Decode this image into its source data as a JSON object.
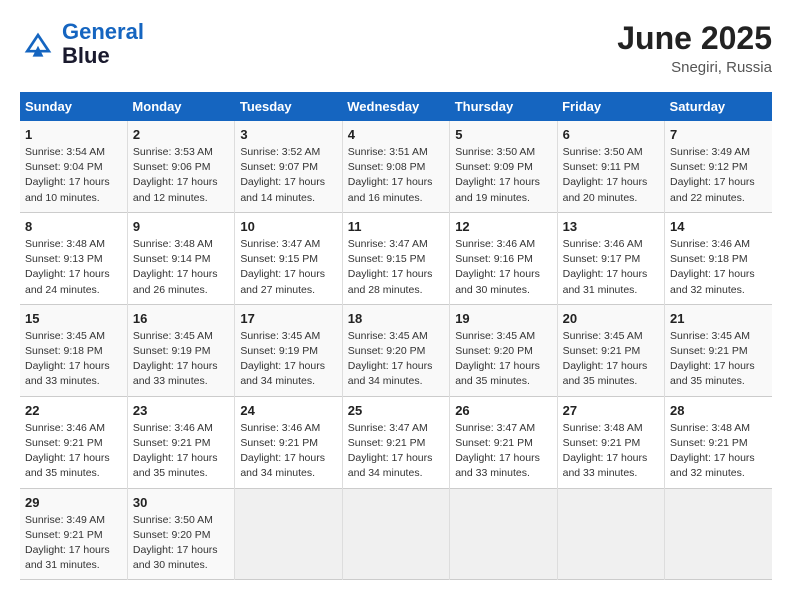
{
  "logo": {
    "line1": "General",
    "line2": "Blue"
  },
  "title": "June 2025",
  "subtitle": "Snegiri, Russia",
  "days_header": [
    "Sunday",
    "Monday",
    "Tuesday",
    "Wednesday",
    "Thursday",
    "Friday",
    "Saturday"
  ],
  "weeks": [
    [
      {
        "num": "1",
        "lines": [
          "Sunrise: 3:54 AM",
          "Sunset: 9:04 PM",
          "Daylight: 17 hours",
          "and 10 minutes."
        ]
      },
      {
        "num": "2",
        "lines": [
          "Sunrise: 3:53 AM",
          "Sunset: 9:06 PM",
          "Daylight: 17 hours",
          "and 12 minutes."
        ]
      },
      {
        "num": "3",
        "lines": [
          "Sunrise: 3:52 AM",
          "Sunset: 9:07 PM",
          "Daylight: 17 hours",
          "and 14 minutes."
        ]
      },
      {
        "num": "4",
        "lines": [
          "Sunrise: 3:51 AM",
          "Sunset: 9:08 PM",
          "Daylight: 17 hours",
          "and 16 minutes."
        ]
      },
      {
        "num": "5",
        "lines": [
          "Sunrise: 3:50 AM",
          "Sunset: 9:09 PM",
          "Daylight: 17 hours",
          "and 19 minutes."
        ]
      },
      {
        "num": "6",
        "lines": [
          "Sunrise: 3:50 AM",
          "Sunset: 9:11 PM",
          "Daylight: 17 hours",
          "and 20 minutes."
        ]
      },
      {
        "num": "7",
        "lines": [
          "Sunrise: 3:49 AM",
          "Sunset: 9:12 PM",
          "Daylight: 17 hours",
          "and 22 minutes."
        ]
      }
    ],
    [
      {
        "num": "8",
        "lines": [
          "Sunrise: 3:48 AM",
          "Sunset: 9:13 PM",
          "Daylight: 17 hours",
          "and 24 minutes."
        ]
      },
      {
        "num": "9",
        "lines": [
          "Sunrise: 3:48 AM",
          "Sunset: 9:14 PM",
          "Daylight: 17 hours",
          "and 26 minutes."
        ]
      },
      {
        "num": "10",
        "lines": [
          "Sunrise: 3:47 AM",
          "Sunset: 9:15 PM",
          "Daylight: 17 hours",
          "and 27 minutes."
        ]
      },
      {
        "num": "11",
        "lines": [
          "Sunrise: 3:47 AM",
          "Sunset: 9:15 PM",
          "Daylight: 17 hours",
          "and 28 minutes."
        ]
      },
      {
        "num": "12",
        "lines": [
          "Sunrise: 3:46 AM",
          "Sunset: 9:16 PM",
          "Daylight: 17 hours",
          "and 30 minutes."
        ]
      },
      {
        "num": "13",
        "lines": [
          "Sunrise: 3:46 AM",
          "Sunset: 9:17 PM",
          "Daylight: 17 hours",
          "and 31 minutes."
        ]
      },
      {
        "num": "14",
        "lines": [
          "Sunrise: 3:46 AM",
          "Sunset: 9:18 PM",
          "Daylight: 17 hours",
          "and 32 minutes."
        ]
      }
    ],
    [
      {
        "num": "15",
        "lines": [
          "Sunrise: 3:45 AM",
          "Sunset: 9:18 PM",
          "Daylight: 17 hours",
          "and 33 minutes."
        ]
      },
      {
        "num": "16",
        "lines": [
          "Sunrise: 3:45 AM",
          "Sunset: 9:19 PM",
          "Daylight: 17 hours",
          "and 33 minutes."
        ]
      },
      {
        "num": "17",
        "lines": [
          "Sunrise: 3:45 AM",
          "Sunset: 9:19 PM",
          "Daylight: 17 hours",
          "and 34 minutes."
        ]
      },
      {
        "num": "18",
        "lines": [
          "Sunrise: 3:45 AM",
          "Sunset: 9:20 PM",
          "Daylight: 17 hours",
          "and 34 minutes."
        ]
      },
      {
        "num": "19",
        "lines": [
          "Sunrise: 3:45 AM",
          "Sunset: 9:20 PM",
          "Daylight: 17 hours",
          "and 35 minutes."
        ]
      },
      {
        "num": "20",
        "lines": [
          "Sunrise: 3:45 AM",
          "Sunset: 9:21 PM",
          "Daylight: 17 hours",
          "and 35 minutes."
        ]
      },
      {
        "num": "21",
        "lines": [
          "Sunrise: 3:45 AM",
          "Sunset: 9:21 PM",
          "Daylight: 17 hours",
          "and 35 minutes."
        ]
      }
    ],
    [
      {
        "num": "22",
        "lines": [
          "Sunrise: 3:46 AM",
          "Sunset: 9:21 PM",
          "Daylight: 17 hours",
          "and 35 minutes."
        ]
      },
      {
        "num": "23",
        "lines": [
          "Sunrise: 3:46 AM",
          "Sunset: 9:21 PM",
          "Daylight: 17 hours",
          "and 35 minutes."
        ]
      },
      {
        "num": "24",
        "lines": [
          "Sunrise: 3:46 AM",
          "Sunset: 9:21 PM",
          "Daylight: 17 hours",
          "and 34 minutes."
        ]
      },
      {
        "num": "25",
        "lines": [
          "Sunrise: 3:47 AM",
          "Sunset: 9:21 PM",
          "Daylight: 17 hours",
          "and 34 minutes."
        ]
      },
      {
        "num": "26",
        "lines": [
          "Sunrise: 3:47 AM",
          "Sunset: 9:21 PM",
          "Daylight: 17 hours",
          "and 33 minutes."
        ]
      },
      {
        "num": "27",
        "lines": [
          "Sunrise: 3:48 AM",
          "Sunset: 9:21 PM",
          "Daylight: 17 hours",
          "and 33 minutes."
        ]
      },
      {
        "num": "28",
        "lines": [
          "Sunrise: 3:48 AM",
          "Sunset: 9:21 PM",
          "Daylight: 17 hours",
          "and 32 minutes."
        ]
      }
    ],
    [
      {
        "num": "29",
        "lines": [
          "Sunrise: 3:49 AM",
          "Sunset: 9:21 PM",
          "Daylight: 17 hours",
          "and 31 minutes."
        ]
      },
      {
        "num": "30",
        "lines": [
          "Sunrise: 3:50 AM",
          "Sunset: 9:20 PM",
          "Daylight: 17 hours",
          "and 30 minutes."
        ]
      },
      {
        "num": "",
        "lines": []
      },
      {
        "num": "",
        "lines": []
      },
      {
        "num": "",
        "lines": []
      },
      {
        "num": "",
        "lines": []
      },
      {
        "num": "",
        "lines": []
      }
    ]
  ]
}
